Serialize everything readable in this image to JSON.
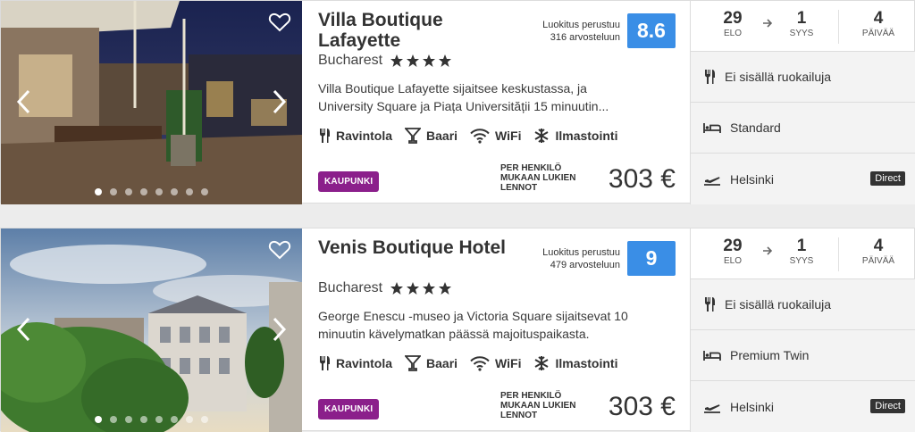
{
  "results": [
    {
      "name": "Villa Boutique Lafayette",
      "city": "Bucharest",
      "stars": 4,
      "rating_label_1": "Luokitus perustuu",
      "rating_label_2": "316 arvosteluun",
      "rating": "8.6",
      "description_1": "Villa Boutique Lafayette sijaitsee keskustassa, ja",
      "description_2": "University Square ja Piața Universității 15 minuutin...",
      "amenities": [
        "Ravintola",
        "Baari",
        "WiFi",
        "Ilmastointi"
      ],
      "tag": "KAUPUNKI",
      "price_label_1": "PER HENKILÖ",
      "price_label_2": "MUKAAN LUKIEN",
      "price_label_3": "LENNOT",
      "price": "303 €",
      "depart_day": "29",
      "depart_month": "ELO",
      "return_day": "1",
      "return_month": "SYYS",
      "nights": "4",
      "nights_label": "PÄIVÄÄ",
      "meals": "Ei sisällä ruokailuja",
      "room": "Standard",
      "departure_city": "Helsinki",
      "flight_type": "Direct",
      "photo_dots": 8,
      "active_dot": 0
    },
    {
      "name": "Venis Boutique Hotel",
      "city": "Bucharest",
      "stars": 4,
      "rating_label_1": "Luokitus perustuu",
      "rating_label_2": "479 arvosteluun",
      "rating": "9",
      "description_1": "George Enescu -museo ja Victoria Square sijaitsevat 10",
      "description_2": "minuutin kävelymatkan päässä majoituspaikasta.",
      "amenities": [
        "Ravintola",
        "Baari",
        "WiFi",
        "Ilmastointi"
      ],
      "tag": "KAUPUNKI",
      "price_label_1": "PER HENKILÖ",
      "price_label_2": "MUKAAN LUKIEN",
      "price_label_3": "LENNOT",
      "price": "303 €",
      "depart_day": "29",
      "depart_month": "ELO",
      "return_day": "1",
      "return_month": "SYYS",
      "nights": "4",
      "nights_label": "PÄIVÄÄ",
      "meals": "Ei sisällä ruokailuja",
      "room": "Premium Twin",
      "departure_city": "Helsinki",
      "flight_type": "Direct",
      "photo_dots": 8,
      "active_dot": 0
    }
  ],
  "colors": {
    "rating_badge": "#3a8ee6",
    "tag": "#8b1f8b",
    "direct_badge": "#333333"
  },
  "icons": [
    "heart-icon",
    "chevron-left-icon",
    "chevron-right-icon",
    "star-icon",
    "cutlery-icon",
    "cocktail-icon",
    "wifi-icon",
    "snowflake-icon",
    "arrow-right-icon",
    "bed-icon",
    "plane-icon"
  ]
}
